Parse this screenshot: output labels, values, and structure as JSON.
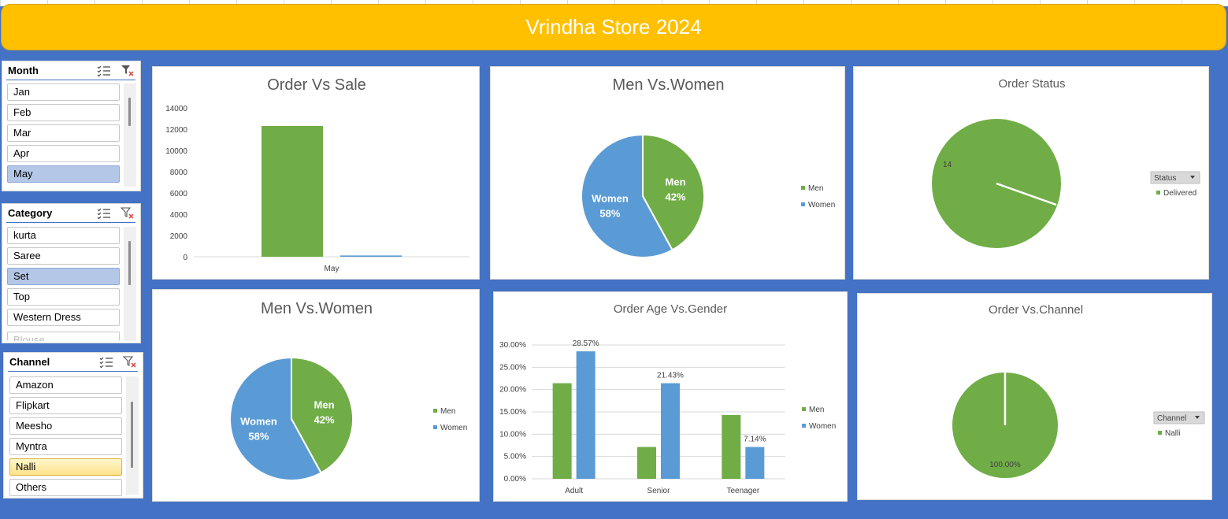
{
  "title": "Vrindha Store 2024",
  "colors": {
    "green": "#70ad47",
    "blue": "#5b9bd5",
    "bg": "#4472c4",
    "banner": "#ffc000"
  },
  "slicers": {
    "month": {
      "title": "Month",
      "items": [
        "Jan",
        "Feb",
        "Mar",
        "Apr",
        "May"
      ],
      "selected": "May"
    },
    "category": {
      "title": "Category",
      "items": [
        "kurta",
        "Saree",
        "Set",
        "Top",
        "Western Dress",
        "Blouse"
      ],
      "selected": "Set"
    },
    "channel": {
      "title": "Channel",
      "items": [
        "Amazon",
        "Flipkart",
        "Meesho",
        "Myntra",
        "Nalli",
        "Others"
      ],
      "selected": "Nalli"
    }
  },
  "icons": {
    "multi_select": "multi-select-icon",
    "clear_filter": "clear-filter-icon"
  },
  "charts": {
    "order_vs_sale": {
      "title": "Order Vs Sale"
    },
    "men_vs_women_1": {
      "title": "Men Vs.Women"
    },
    "order_status": {
      "title": "Order Status",
      "filter_button": "Status",
      "data_label": "14"
    },
    "men_vs_women_2": {
      "title": "Men Vs.Women"
    },
    "order_age_gender": {
      "title": "Order Age Vs.Gender"
    },
    "order_channel": {
      "title": "Order Vs.Channel",
      "filter_button": "Channel",
      "data_label": "100.00%"
    }
  },
  "chart_data": [
    {
      "id": "order_vs_sale",
      "type": "bar",
      "title": "Order Vs Sale",
      "categories": [
        "May"
      ],
      "series": [
        {
          "values": [
            12300
          ],
          "color": "#70ad47"
        },
        {
          "values": [
            120
          ],
          "color": "#5b9bd5"
        }
      ],
      "yticks": [
        "0",
        "2000",
        "4000",
        "6000",
        "8000",
        "10000",
        "12000",
        "14000"
      ],
      "ylim": [
        0,
        14000
      ],
      "legend": "none"
    },
    {
      "id": "men_vs_women_1",
      "type": "pie",
      "title": "Men Vs.Women",
      "labels": [
        "Men",
        "Women"
      ],
      "values": [
        42,
        58
      ],
      "data_labels": [
        "42%",
        "58%"
      ],
      "colors": [
        "#70ad47",
        "#5b9bd5"
      ],
      "legend": "right"
    },
    {
      "id": "order_status",
      "type": "pie",
      "title": "Order Status",
      "labels": [
        "Delivered"
      ],
      "values": [
        14
      ],
      "data_labels": [
        "14"
      ],
      "colors": [
        "#70ad47"
      ],
      "legend": "right"
    },
    {
      "id": "men_vs_women_2",
      "type": "pie",
      "title": "Men Vs.Women",
      "labels": [
        "Men",
        "Women"
      ],
      "values": [
        42,
        58
      ],
      "data_labels": [
        "42%",
        "58%"
      ],
      "colors": [
        "#70ad47",
        "#5b9bd5"
      ],
      "legend": "right"
    },
    {
      "id": "order_age_gender",
      "type": "bar",
      "title": "Order Age Vs.Gender",
      "categories": [
        "Adult",
        "Senior",
        "Teenager"
      ],
      "series": [
        {
          "name": "Men",
          "values": [
            21.43,
            7.14,
            14.29
          ],
          "color": "#70ad47",
          "data_labels": [
            "",
            "",
            ""
          ]
        },
        {
          "name": "Women",
          "values": [
            28.57,
            21.43,
            7.14
          ],
          "color": "#5b9bd5",
          "data_labels": [
            "28.57%",
            "21.43%",
            "7.14%"
          ]
        }
      ],
      "yticks": [
        "0.00%",
        "5.00%",
        "10.00%",
        "15.00%",
        "20.00%",
        "25.00%",
        "30.00%"
      ],
      "ylim": [
        0,
        30
      ],
      "grid": true,
      "legend": "right"
    },
    {
      "id": "order_channel",
      "type": "pie",
      "title": "Order Vs.Channel",
      "labels": [
        "Nalli"
      ],
      "values": [
        100
      ],
      "data_labels": [
        "100.00%"
      ],
      "colors": [
        "#70ad47"
      ],
      "legend": "right"
    }
  ]
}
